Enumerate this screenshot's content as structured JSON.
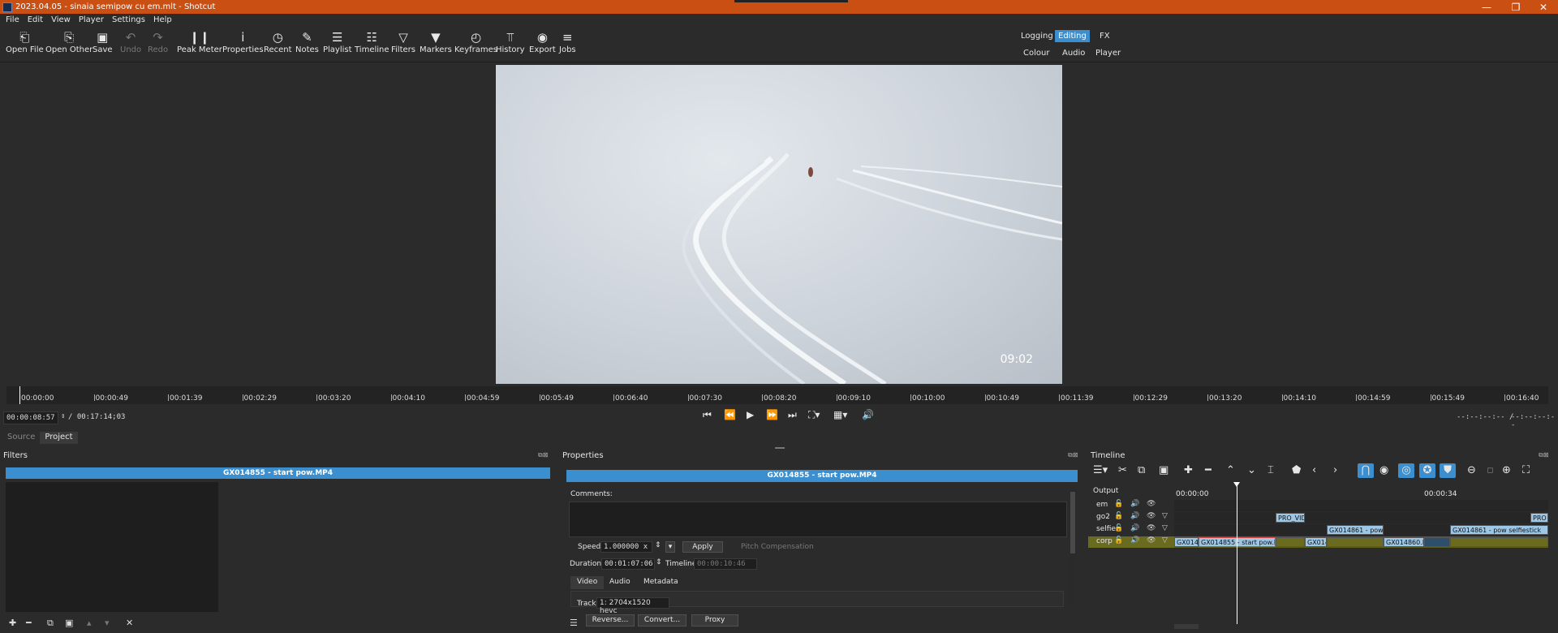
{
  "window": {
    "title": "2023.04.05 - sinaia semipow cu em.mlt - Shotcut",
    "minimize": "—",
    "maximize": "❐",
    "close": "✕"
  },
  "menu": [
    "File",
    "Edit",
    "View",
    "Player",
    "Settings",
    "Help"
  ],
  "toolbar": [
    {
      "label": "Open File",
      "icon": "⎗"
    },
    {
      "label": "Open Other",
      "icon": "⎘"
    },
    {
      "label": "Save",
      "icon": "▣"
    },
    {
      "label": "Undo",
      "icon": "↶"
    },
    {
      "label": "Redo",
      "icon": "↷"
    },
    {
      "label": "Peak Meter",
      "icon": "❙❙"
    },
    {
      "label": "Properties",
      "icon": "i"
    },
    {
      "label": "Recent",
      "icon": "◷"
    },
    {
      "label": "Notes",
      "icon": "✎"
    },
    {
      "label": "Playlist",
      "icon": "☰"
    },
    {
      "label": "Timeline",
      "icon": "☷"
    },
    {
      "label": "Filters",
      "icon": "▽"
    },
    {
      "label": "Markers",
      "icon": "▼"
    },
    {
      "label": "Keyframes",
      "icon": "◴"
    },
    {
      "label": "History",
      "icon": "⫪"
    },
    {
      "label": "Export",
      "icon": "◉"
    },
    {
      "label": "Jobs",
      "icon": "≡"
    }
  ],
  "layouts": {
    "row1": [
      "Logging",
      "Editing",
      "FX"
    ],
    "row2": [
      "Colour",
      "Audio",
      "Player"
    ],
    "active": "Editing"
  },
  "player": {
    "overlay_time": "09:02",
    "ruler_labels": [
      "00:00:00",
      "00:00:49",
      "00:01:39",
      "00:02:29",
      "00:03:20",
      "00:04:10",
      "00:04:59",
      "00:05:49",
      "00:06:40",
      "00:07:30",
      "00:08:20",
      "00:09:10",
      "00:10:00",
      "00:10:49",
      "00:11:39",
      "00:12:29",
      "00:13:20",
      "00:14:10",
      "00:14:59",
      "00:15:49",
      "00:16:40"
    ],
    "current_time": "00:00:08:57",
    "total_time": "/ 00:17:14;03",
    "in_point": "--:--:--:-- /",
    "out_point": "--:--:--:--",
    "tabs": [
      "Source",
      "Project"
    ],
    "active_tab": "Project"
  },
  "filters": {
    "title": "Filters",
    "clip_name": "GX014855 - start pow.MP4"
  },
  "properties": {
    "title": "Properties",
    "clip_name": "GX014855 - start pow.MP4",
    "comments_label": "Comments:",
    "speed_label": "Speed",
    "speed_value": "1.000000 x",
    "apply": "Apply",
    "pitch": "Pitch Compensation",
    "duration_label": "Duration",
    "duration_value": "00:01:07:06",
    "timeline_label": "Timeline",
    "timeline_value": "00:00:10:46",
    "tabs": [
      "Video",
      "Audio",
      "Metadata"
    ],
    "track_label": "Track",
    "track_value": "1: 2704x1520 hevc",
    "buttons": [
      "Reverse...",
      "Convert...",
      "Proxy"
    ]
  },
  "timeline": {
    "title": "Timeline",
    "output_label": "Output",
    "ruler": [
      "00:00:00",
      "00:00:34"
    ],
    "tracks": [
      {
        "name": "em"
      },
      {
        "name": "go2"
      },
      {
        "name": "selfie"
      },
      {
        "name": "corp"
      }
    ],
    "clips": {
      "go2_a": "PRO_VID",
      "go2_b": "PRO",
      "selfie_a": "GX014861 - pow se",
      "selfie_b": "GX014861 - pow selfiestick",
      "corp_a": "GX0148",
      "corp_b": "GX014855 - start pow.MP",
      "corp_c": "GX014",
      "corp_d": "GX014860.MP4"
    }
  }
}
